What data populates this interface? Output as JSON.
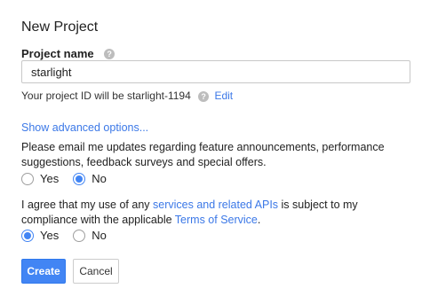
{
  "dialog": {
    "title": "New Project",
    "project_name_label": "Project name",
    "project_name_value": "starlight",
    "project_id_prefix": "Your project ID will be starlight-1194",
    "edit_link": "Edit",
    "advanced_link": "Show advanced options...",
    "email_question": "Please email me updates regarding feature announcements, performance suggestions, feedback surveys and special offers.",
    "email_options": {
      "yes": "Yes",
      "no": "No",
      "selected": "No"
    },
    "agree_text_1": "I agree that my use of any ",
    "agree_link_1": "services and related APIs",
    "agree_text_2": " is subject to my compliance with the applicable ",
    "agree_link_2": "Terms of Service",
    "agree_text_3": ".",
    "agree_options": {
      "yes": "Yes",
      "no": "No",
      "selected": "Yes"
    },
    "create_button": "Create",
    "cancel_button": "Cancel"
  },
  "colors": {
    "accent": "#4285f4",
    "link": "#3b78e7"
  },
  "icons": {
    "help": "help-icon"
  }
}
